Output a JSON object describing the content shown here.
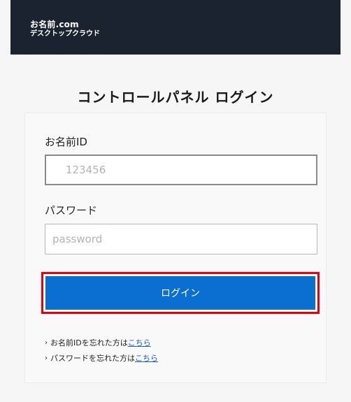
{
  "header": {
    "brand_line1": "お名前.com",
    "brand_line2": "デスクトップクラウド"
  },
  "page_title": "コントロールパネル ログイン",
  "form": {
    "id_label": "お名前ID",
    "id_placeholder": "123456",
    "password_label": "パスワード",
    "password_placeholder": "password",
    "login_button": "ログイン"
  },
  "help": {
    "forgot_id_text": "お名前IDを忘れた方は",
    "forgot_id_link": "こちら",
    "forgot_pw_text": "パスワードを忘れた方は",
    "forgot_pw_link": "こちら"
  },
  "colors": {
    "header_bg": "#1b2330",
    "button_bg": "#0b6fd1",
    "highlight": "#e60012",
    "link": "#1a5fc9"
  }
}
